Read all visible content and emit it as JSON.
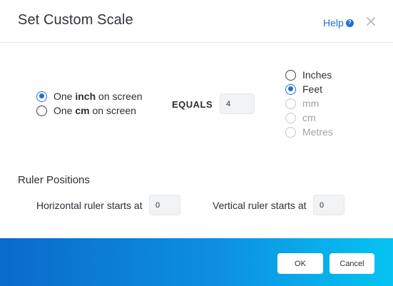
{
  "header": {
    "title": "Set Custom Scale",
    "help_label": "Help",
    "help_icon": "question-circle-icon",
    "close_icon": "close-icon"
  },
  "scale": {
    "screen_options": [
      {
        "prefix": "One ",
        "unit": "inch",
        "suffix": " on screen",
        "checked": true
      },
      {
        "prefix": "One ",
        "unit": "cm",
        "suffix": " on screen",
        "checked": false
      }
    ],
    "equals_label": "EQUALS",
    "value": "4",
    "units": [
      {
        "label": "Inches",
        "checked": false,
        "disabled": false
      },
      {
        "label": "Feet",
        "checked": true,
        "disabled": false
      },
      {
        "label": "mm",
        "checked": false,
        "disabled": true
      },
      {
        "label": "cm",
        "checked": false,
        "disabled": true
      },
      {
        "label": "Metres",
        "checked": false,
        "disabled": true
      }
    ]
  },
  "ruler": {
    "title": "Ruler Positions",
    "horizontal_label": "Horizontal ruler starts at",
    "horizontal_value": "0",
    "vertical_label": "Vertical ruler starts at",
    "vertical_value": "0"
  },
  "footer": {
    "ok_label": "OK",
    "cancel_label": "Cancel"
  },
  "colors": {
    "accent": "#1f6fd6",
    "footer_start": "#0a6bc9",
    "footer_end": "#06c3f3"
  }
}
